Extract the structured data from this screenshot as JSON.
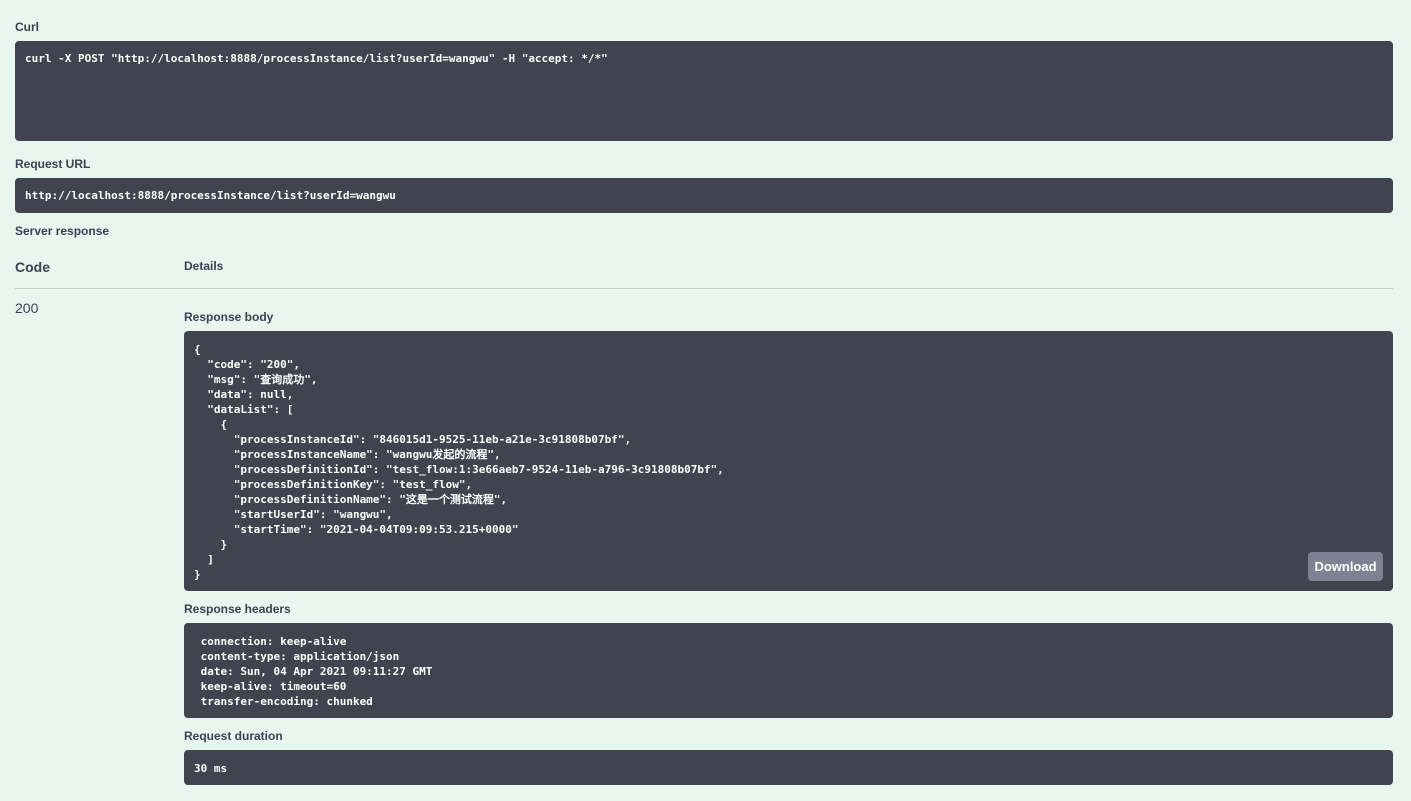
{
  "curl": {
    "label": "Curl",
    "command": "curl -X POST \"http://localhost:8888/processInstance/list?userId=wangwu\" -H \"accept: */*\""
  },
  "request_url": {
    "label": "Request URL",
    "value": "http://localhost:8888/processInstance/list?userId=wangwu"
  },
  "server_response": {
    "label": "Server response",
    "code_header": "Code",
    "details_header": "Details",
    "code": "200",
    "response_body_label": "Response body",
    "response_body": "{\n  \"code\": \"200\",\n  \"msg\": \"查询成功\",\n  \"data\": null,\n  \"dataList\": [\n    {\n      \"processInstanceId\": \"846015d1-9525-11eb-a21e-3c91808b07bf\",\n      \"processInstanceName\": \"wangwu发起的流程\",\n      \"processDefinitionId\": \"test_flow:1:3e66aeb7-9524-11eb-a796-3c91808b07bf\",\n      \"processDefinitionKey\": \"test_flow\",\n      \"processDefinitionName\": \"这是一个测试流程\",\n      \"startUserId\": \"wangwu\",\n      \"startTime\": \"2021-04-04T09:09:53.215+0000\"\n    }\n  ]\n}",
    "download_label": "Download",
    "response_headers_label": "Response headers",
    "response_headers": " connection: keep-alive \n content-type: application/json \n date: Sun, 04 Apr 2021 09:11:27 GMT \n keep-alive: timeout=60 \n transfer-encoding: chunked ",
    "request_duration_label": "Request duration",
    "request_duration": "30 ms"
  },
  "colors": {
    "background": "#e8f6f0",
    "code_block": "#41444e",
    "download_button": "#7d8293"
  }
}
